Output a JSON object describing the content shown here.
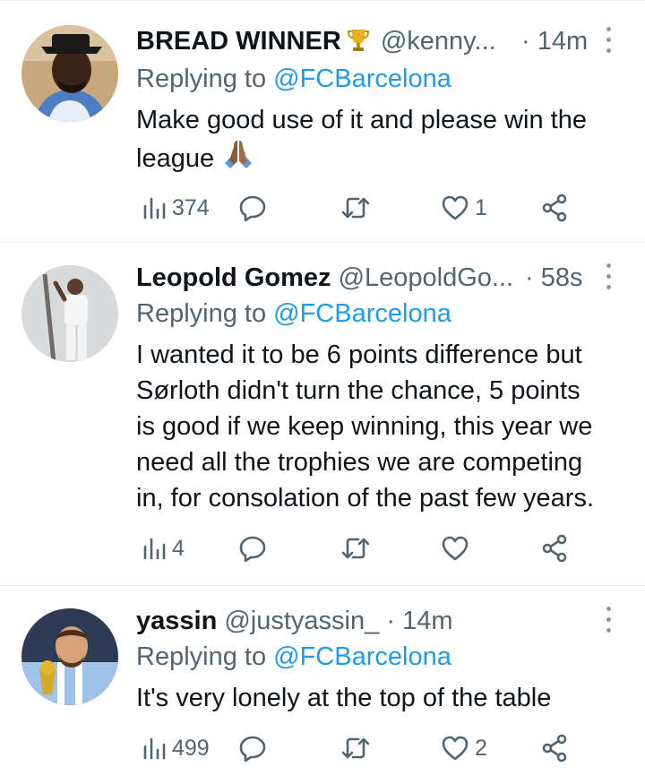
{
  "tweets": [
    {
      "name": "BREAD WINNER",
      "badge_icon": "trophy-icon",
      "handle": "@kenny...",
      "dot": "·",
      "time": "14m",
      "replying_prefix": "Replying to ",
      "replying_to": "@FCBarcelona",
      "text_lines": [
        "Make good use of it and please win the",
        "league"
      ],
      "emoji": "folded-hands-icon",
      "views": "374",
      "replies": "",
      "retweets": "",
      "likes": "1"
    },
    {
      "name": "Leopold Gomez",
      "handle": "@LeopoldGo...",
      "dot": "·",
      "time": "58s",
      "replying_prefix": "Replying to ",
      "replying_to": "@FCBarcelona",
      "text_lines": [
        "I wanted it to be 6 points difference but",
        "Sørloth didn't turn the chance, 5 points",
        "is good if we keep winning, this year we",
        "need all the trophies we are competing",
        "in, for consolation of the past few years."
      ],
      "views": "4",
      "replies": "",
      "retweets": "",
      "likes": ""
    },
    {
      "name": "yassin",
      "handle": "@justyassin_",
      "dot": "·",
      "time": "14m",
      "replying_prefix": "Replying to ",
      "replying_to": "@FCBarcelona",
      "text_lines": [
        "It's very lonely at the top of the table"
      ],
      "views": "499",
      "replies": "",
      "retweets": "",
      "likes": "2"
    }
  ],
  "colors": {
    "text": "#0f1419",
    "secondary": "#536471",
    "link": "#1d9bf0",
    "divider": "#e6ecf0",
    "more_dots": "#8b98a5"
  }
}
